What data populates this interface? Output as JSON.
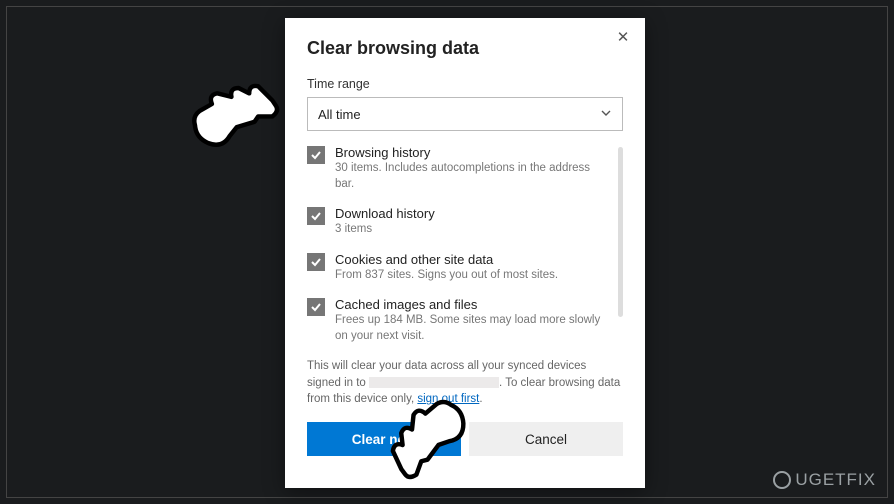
{
  "dialog": {
    "title": "Clear browsing data",
    "time_range_label": "Time range",
    "time_range_value": "All time",
    "options": [
      {
        "label": "Browsing history",
        "desc": "30 items. Includes autocompletions in the address bar."
      },
      {
        "label": "Download history",
        "desc": "3 items"
      },
      {
        "label": "Cookies and other site data",
        "desc": "From 837 sites. Signs you out of most sites."
      },
      {
        "label": "Cached images and files",
        "desc": "Frees up 184 MB. Some sites may load more slowly on your next visit."
      }
    ],
    "sync_note_pre": "This will clear your data across all your synced devices signed in to ",
    "sync_note_mid": ". To clear browsing data from this device only, ",
    "sync_link": "sign out first",
    "sync_note_end": ".",
    "clear_label": "Clear now",
    "cancel_label": "Cancel"
  },
  "watermark": "UGETFIX"
}
